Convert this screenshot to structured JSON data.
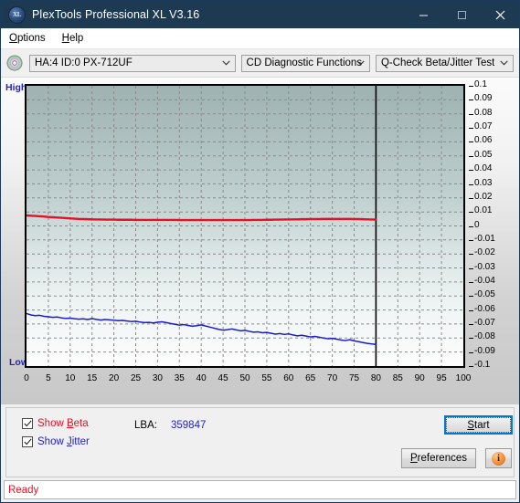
{
  "window": {
    "title": "PlexTools Professional XL V3.16",
    "icon": "XL",
    "minimize_label": "minimize-icon",
    "maximize_label": "maximize-icon",
    "close_label": "close-icon"
  },
  "menubar": {
    "items": [
      {
        "label": "Options",
        "accel": "O"
      },
      {
        "label": "Help",
        "accel": "H"
      }
    ]
  },
  "toolbar": {
    "drive_select": "HA:4 ID:0  PX-712UF",
    "function_select": "CD Diagnostic Functions",
    "test_select": "Q-Check Beta/Jitter Test"
  },
  "chart_data": {
    "type": "line",
    "title": "Q-Check Beta/Jitter Test",
    "xlabel": "",
    "ylabel": "",
    "high_label": "High",
    "low_label": "Low",
    "grid": true,
    "legend_position": "bottom-left",
    "xlim": [
      0,
      100
    ],
    "ylim": [
      -0.1,
      0.1
    ],
    "xticks": [
      0,
      5,
      10,
      15,
      20,
      25,
      30,
      35,
      40,
      45,
      50,
      55,
      60,
      65,
      70,
      75,
      80,
      85,
      90,
      95,
      100
    ],
    "yticks": [
      0.1,
      0.09,
      0.08,
      0.07,
      0.06,
      0.05,
      0.04,
      0.03,
      0.02,
      0.01,
      0,
      -0.01,
      -0.02,
      -0.03,
      -0.04,
      -0.05,
      -0.06,
      -0.07,
      -0.08,
      -0.09,
      -0.1
    ],
    "data_end_marker_x": 80,
    "series": [
      {
        "name": "Beta",
        "color": "#e81123",
        "x": [
          0,
          1,
          2,
          3,
          4,
          5,
          6,
          7,
          8,
          9,
          10,
          11,
          12,
          13,
          14,
          15,
          16,
          17,
          18,
          19,
          20,
          21,
          22,
          23,
          24,
          25,
          26,
          27,
          28,
          29,
          30,
          31,
          32,
          33,
          34,
          35,
          36,
          37,
          38,
          39,
          40,
          41,
          42,
          43,
          44,
          45,
          46,
          47,
          48,
          49,
          50,
          51,
          52,
          53,
          54,
          55,
          56,
          57,
          58,
          59,
          60,
          61,
          62,
          63,
          64,
          65,
          66,
          67,
          68,
          69,
          70,
          71,
          72,
          73,
          74,
          75,
          76,
          77,
          78,
          79,
          80
        ],
        "values": [
          0.0075,
          0.0073,
          0.0071,
          0.0069,
          0.0067,
          0.0064,
          0.0062,
          0.006,
          0.0058,
          0.0056,
          0.0054,
          0.0052,
          0.005,
          0.0049,
          0.0048,
          0.0047,
          0.0046,
          0.0046,
          0.0045,
          0.0045,
          0.0045,
          0.0044,
          0.0044,
          0.0044,
          0.0044,
          0.0043,
          0.0043,
          0.0043,
          0.0043,
          0.0043,
          0.0043,
          0.0043,
          0.0043,
          0.0043,
          0.0043,
          0.0042,
          0.0042,
          0.0042,
          0.0042,
          0.0042,
          0.0042,
          0.0042,
          0.0042,
          0.0042,
          0.0042,
          0.0042,
          0.0042,
          0.0042,
          0.0042,
          0.0042,
          0.0042,
          0.0042,
          0.0043,
          0.0043,
          0.0043,
          0.0044,
          0.0044,
          0.0045,
          0.0045,
          0.0046,
          0.0046,
          0.0047,
          0.0047,
          0.0048,
          0.0048,
          0.0049,
          0.0049,
          0.0049,
          0.005,
          0.005,
          0.005,
          0.005,
          0.005,
          0.005,
          0.005,
          0.0049,
          0.0049,
          0.0048,
          0.0047,
          0.0046,
          0.0045
        ]
      },
      {
        "name": "Jitter",
        "color": "#1a1ad0",
        "x": [
          0,
          1,
          2,
          3,
          4,
          5,
          6,
          7,
          8,
          9,
          10,
          11,
          12,
          13,
          14,
          15,
          16,
          17,
          18,
          19,
          20,
          21,
          22,
          23,
          24,
          25,
          26,
          27,
          28,
          29,
          30,
          31,
          32,
          33,
          34,
          35,
          36,
          37,
          38,
          39,
          40,
          41,
          42,
          43,
          44,
          45,
          46,
          47,
          48,
          49,
          50,
          51,
          52,
          53,
          54,
          55,
          56,
          57,
          58,
          59,
          60,
          61,
          62,
          63,
          64,
          65,
          66,
          67,
          68,
          69,
          70,
          71,
          72,
          73,
          74,
          75,
          76,
          77,
          78,
          79,
          80
        ],
        "values": [
          -0.0625,
          -0.0635,
          -0.064,
          -0.0638,
          -0.0645,
          -0.0648,
          -0.0652,
          -0.065,
          -0.0656,
          -0.066,
          -0.0658,
          -0.0662,
          -0.0665,
          -0.0663,
          -0.0668,
          -0.0661,
          -0.0667,
          -0.0672,
          -0.0668,
          -0.067,
          -0.0673,
          -0.0676,
          -0.0674,
          -0.0678,
          -0.0682,
          -0.068,
          -0.0686,
          -0.069,
          -0.0688,
          -0.0692,
          -0.0687,
          -0.0684,
          -0.069,
          -0.0696,
          -0.0702,
          -0.0708,
          -0.0704,
          -0.071,
          -0.0716,
          -0.0712,
          -0.0706,
          -0.0714,
          -0.0722,
          -0.073,
          -0.0738,
          -0.0744,
          -0.074,
          -0.0735,
          -0.0742,
          -0.0748,
          -0.0745,
          -0.0752,
          -0.0758,
          -0.0756,
          -0.0762,
          -0.076,
          -0.0766,
          -0.0772,
          -0.0768,
          -0.0774,
          -0.077,
          -0.0778,
          -0.0784,
          -0.078,
          -0.0786,
          -0.0792,
          -0.0788,
          -0.0794,
          -0.08,
          -0.0805,
          -0.0802,
          -0.0808,
          -0.0814,
          -0.0818,
          -0.0812,
          -0.082,
          -0.0826,
          -0.0832,
          -0.0838,
          -0.0842,
          -0.0845
        ]
      }
    ]
  },
  "controls": {
    "show_beta_label": "Show Beta",
    "show_beta_accel": "B",
    "show_beta_checked": true,
    "show_jitter_label": "Show Jitter",
    "show_jitter_accel": "J",
    "show_jitter_checked": true,
    "lba_label": "LBA:",
    "lba_value": "359847",
    "start_label": "Start",
    "start_accel": "S",
    "preferences_label": "Preferences",
    "preferences_accel": "P",
    "info_label": "i"
  },
  "statusbar": {
    "text": "Ready"
  },
  "colors": {
    "title_bar": "#1e3a52",
    "beta": "#e81123",
    "jitter": "#1a1ad0",
    "accent_focus": "#0078d7",
    "status": "#e81123"
  }
}
